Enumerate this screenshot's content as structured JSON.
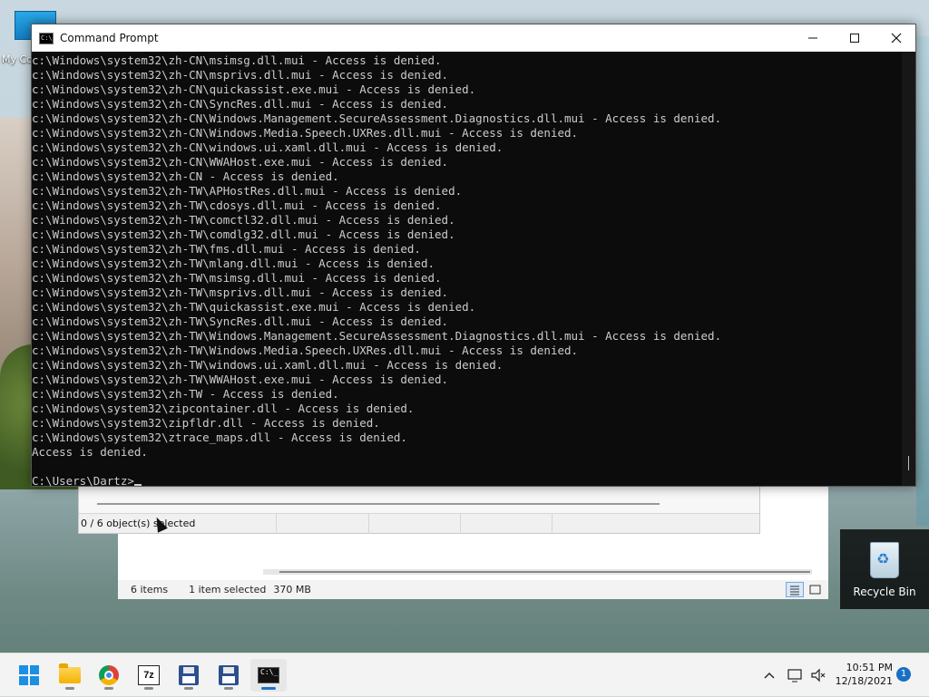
{
  "desktop": {
    "my_computer_label": "My Co",
    "recycle_bin_label": "Recycle Bin"
  },
  "cmd": {
    "title": "Command Prompt",
    "icon_text": "C:\\",
    "lines": [
      "c:\\Windows\\system32\\zh-CN\\msimsg.dll.mui - Access is denied.",
      "c:\\Windows\\system32\\zh-CN\\msprivs.dll.mui - Access is denied.",
      "c:\\Windows\\system32\\zh-CN\\quickassist.exe.mui - Access is denied.",
      "c:\\Windows\\system32\\zh-CN\\SyncRes.dll.mui - Access is denied.",
      "c:\\Windows\\system32\\zh-CN\\Windows.Management.SecureAssessment.Diagnostics.dll.mui - Access is denied.",
      "c:\\Windows\\system32\\zh-CN\\Windows.Media.Speech.UXRes.dll.mui - Access is denied.",
      "c:\\Windows\\system32\\zh-CN\\windows.ui.xaml.dll.mui - Access is denied.",
      "c:\\Windows\\system32\\zh-CN\\WWAHost.exe.mui - Access is denied.",
      "c:\\Windows\\system32\\zh-CN - Access is denied.",
      "c:\\Windows\\system32\\zh-TW\\APHostRes.dll.mui - Access is denied.",
      "c:\\Windows\\system32\\zh-TW\\cdosys.dll.mui - Access is denied.",
      "c:\\Windows\\system32\\zh-TW\\comctl32.dll.mui - Access is denied.",
      "c:\\Windows\\system32\\zh-TW\\comdlg32.dll.mui - Access is denied.",
      "c:\\Windows\\system32\\zh-TW\\fms.dll.mui - Access is denied.",
      "c:\\Windows\\system32\\zh-TW\\mlang.dll.mui - Access is denied.",
      "c:\\Windows\\system32\\zh-TW\\msimsg.dll.mui - Access is denied.",
      "c:\\Windows\\system32\\zh-TW\\msprivs.dll.mui - Access is denied.",
      "c:\\Windows\\system32\\zh-TW\\quickassist.exe.mui - Access is denied.",
      "c:\\Windows\\system32\\zh-TW\\SyncRes.dll.mui - Access is denied.",
      "c:\\Windows\\system32\\zh-TW\\Windows.Management.SecureAssessment.Diagnostics.dll.mui - Access is denied.",
      "c:\\Windows\\system32\\zh-TW\\Windows.Media.Speech.UXRes.dll.mui - Access is denied.",
      "c:\\Windows\\system32\\zh-TW\\windows.ui.xaml.dll.mui - Access is denied.",
      "c:\\Windows\\system32\\zh-TW\\WWAHost.exe.mui - Access is denied.",
      "c:\\Windows\\system32\\zh-TW - Access is denied.",
      "c:\\Windows\\system32\\zipcontainer.dll - Access is denied.",
      "c:\\Windows\\system32\\zipfldr.dll - Access is denied.",
      "c:\\Windows\\system32\\ztrace_maps.dll - Access is denied.",
      "Access is denied.",
      "",
      "C:\\Users\\Dartz>"
    ]
  },
  "sevenzip": {
    "status_selected": "0 / 6 object(s) selected"
  },
  "explorer": {
    "status_items": "6 items",
    "status_selection": "1 item selected",
    "status_size": "370 MB"
  },
  "taskbar": {
    "sevenz_label": "7z",
    "terminal_text": "C:\\_",
    "time": "10:51 PM",
    "date": "12/18/2021",
    "notification_count": "1"
  },
  "icons": {
    "start": "windows-logo-icon",
    "explorer": "folder-icon",
    "chrome": "chrome-icon",
    "sevenzip": "7zip-icon",
    "floppy": "floppy-disk-icon",
    "cmd": "terminal-icon"
  }
}
